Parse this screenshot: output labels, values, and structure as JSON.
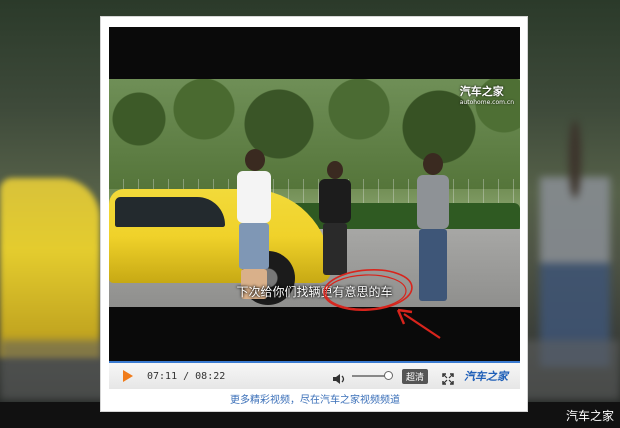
{
  "video": {
    "logo": {
      "name": "汽车之家",
      "domain": "autohome.com.cn"
    },
    "subtitle": "下次给你们找辆更有意思的车"
  },
  "player": {
    "current_time": "07:11",
    "total_time": "08:22",
    "time_display": "07:11 / 08:22",
    "quality_label": "超清",
    "brand_label": "汽车之家",
    "volume_level": 1.0,
    "accent_color": "#f07b1a",
    "progress_color": "#3b7bd1"
  },
  "footer": {
    "more_videos_link": "更多精彩视频，尽在汽车之家视频频道"
  },
  "page": {
    "watermark": "汽车之家"
  },
  "annotation": {
    "color": "#d8241c",
    "type": "hand-drawn circle and arrow highlighting subtitle"
  }
}
